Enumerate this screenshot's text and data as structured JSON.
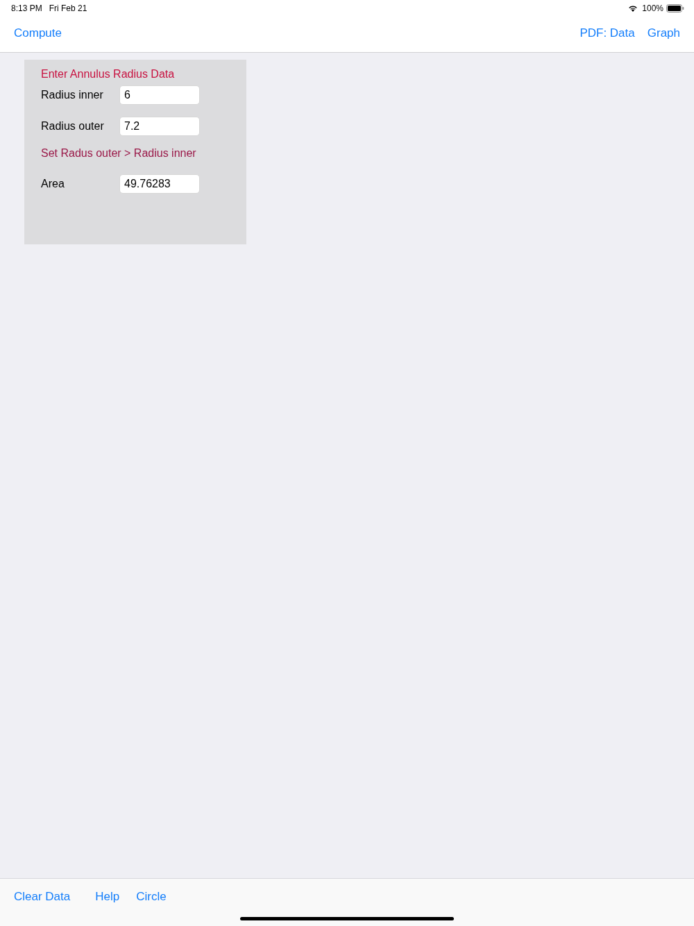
{
  "status_bar": {
    "time": "8:13 PM",
    "date": "Fri Feb 21",
    "battery": "100%"
  },
  "nav_bar": {
    "left": [
      "Compute"
    ],
    "right": [
      "PDF: Data",
      "Graph"
    ]
  },
  "panel": {
    "title": "Enter Annulus Radius Data",
    "inputs": [
      {
        "label": "Radius inner",
        "value": "6"
      },
      {
        "label": "Radius outer",
        "value": "7.2"
      }
    ],
    "note": "Set Radus outer > Radius inner",
    "result": {
      "label": "Area",
      "value": "49.76283"
    }
  },
  "toolbar": [
    "Clear Data",
    "Help",
    "Circle"
  ]
}
